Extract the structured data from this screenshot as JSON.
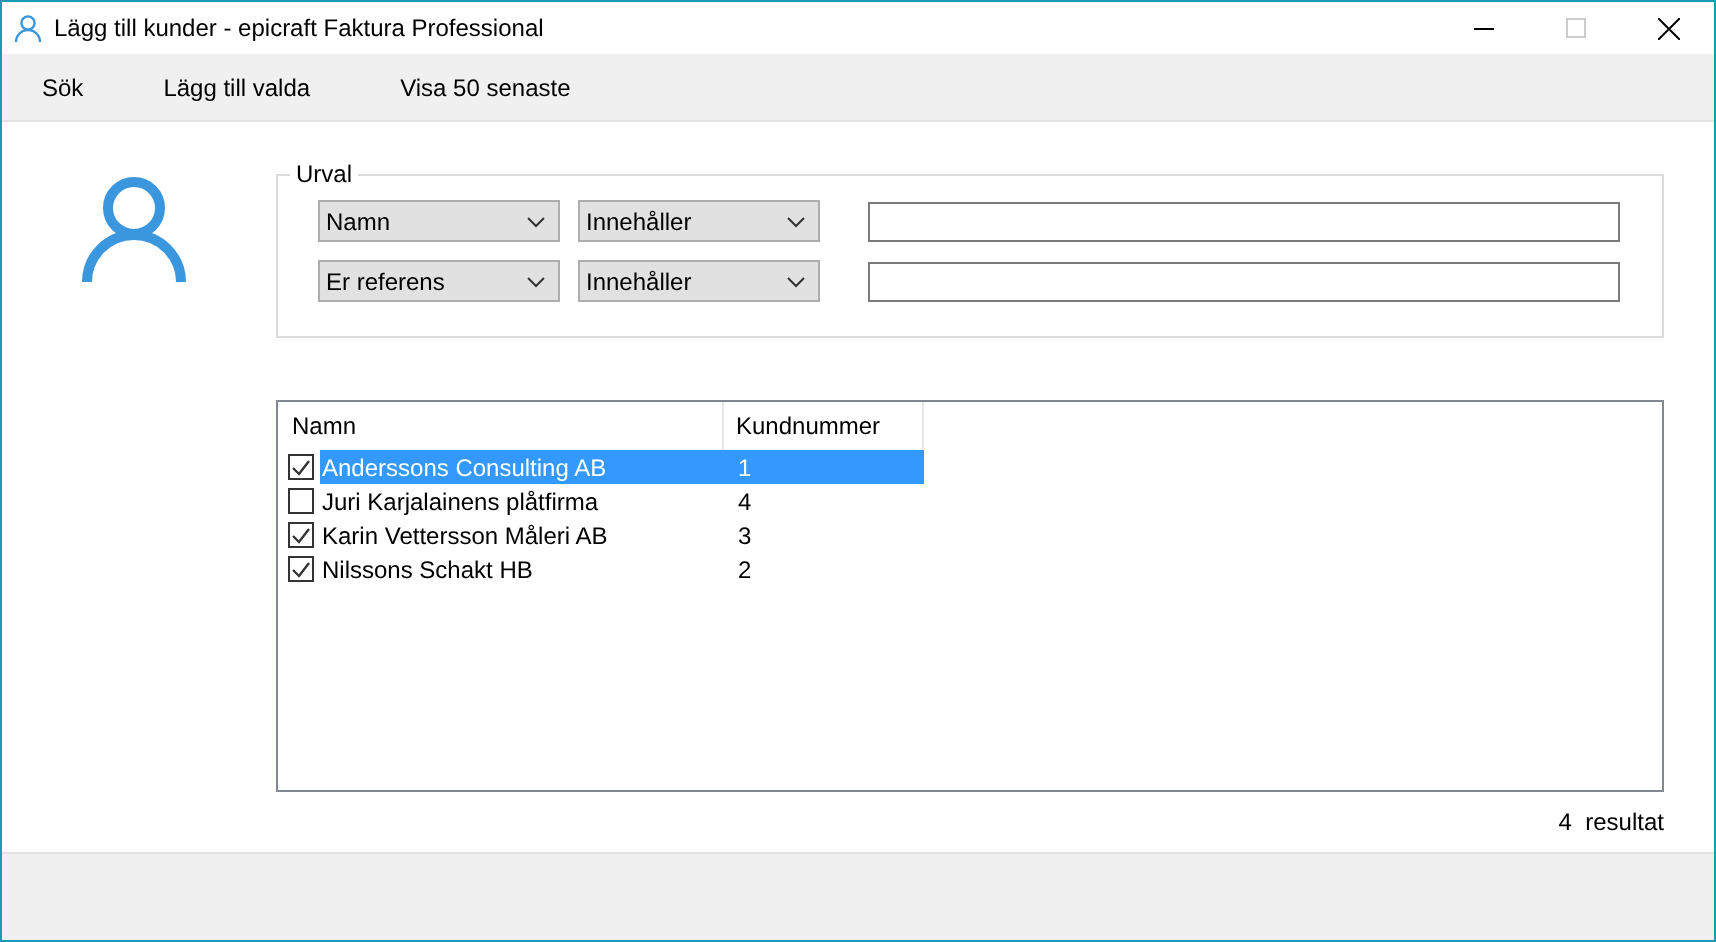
{
  "window": {
    "title": "Lägg till kunder - epicraft Faktura Professional"
  },
  "toolbar": [
    "Sök",
    "Lägg till valda",
    "Visa 50 senaste"
  ],
  "filter": {
    "title": "Urval",
    "rows": [
      {
        "field": "Namn",
        "operator": "Innehåller"
      },
      {
        "field": "Er referens",
        "operator": "Innehåller"
      }
    ]
  },
  "table": {
    "columns": [
      "Namn",
      "Kundnummer"
    ],
    "rows": [
      {
        "name": "Anderssons Consulting AB",
        "number": "1",
        "checked": true,
        "selected": true
      },
      {
        "name": "Juri Karjalainens plåtfirma",
        "number": "4",
        "checked": false,
        "selected": false
      },
      {
        "name": "Karin Vettersson Måleri AB",
        "number": "3",
        "checked": true,
        "selected": false
      },
      {
        "name": "Nilssons Schakt HB",
        "number": "2",
        "checked": true,
        "selected": false
      }
    ]
  },
  "result_count": "4  resultat"
}
